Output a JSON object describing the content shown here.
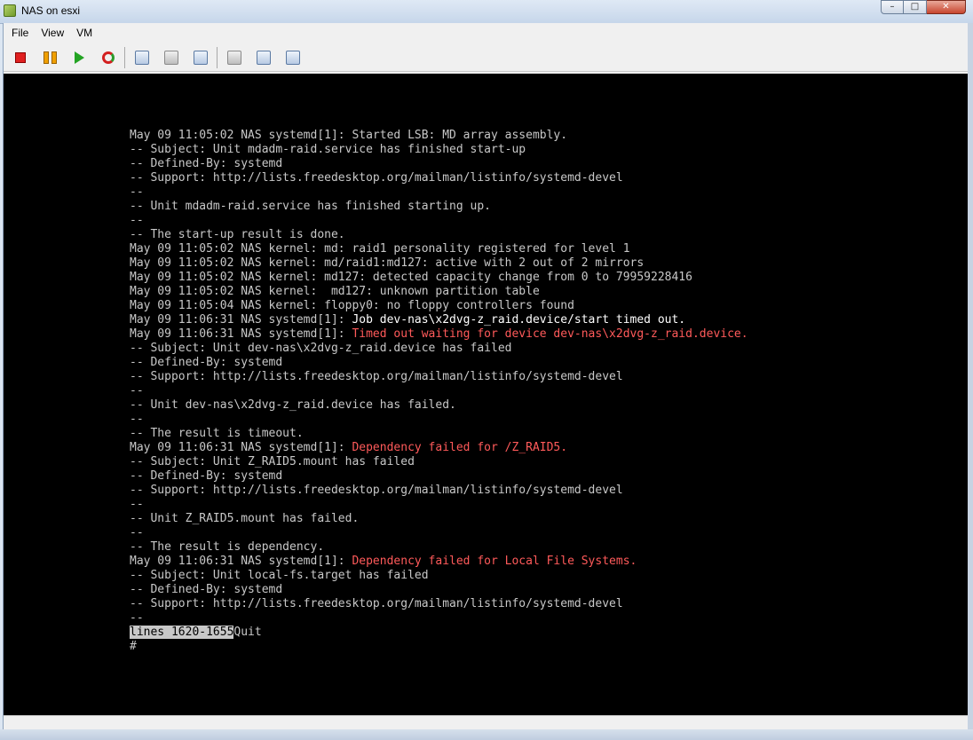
{
  "window": {
    "title": "NAS on esxi",
    "controls": [
      "–",
      "□",
      "✕"
    ]
  },
  "menu": [
    "File",
    "View",
    "VM"
  ],
  "toolbar": {
    "buttons": [
      {
        "name": "power-off-button",
        "icon": "stop-icon"
      },
      {
        "name": "suspend-button",
        "icon": "pause-icon"
      },
      {
        "name": "power-on-button",
        "icon": "play-icon"
      },
      {
        "name": "reset-button",
        "icon": "reset-icon"
      },
      {
        "name": "snapshot-button",
        "icon": "snapshot-icon"
      },
      {
        "name": "revert-snapshot-button",
        "icon": "revert-icon"
      },
      {
        "name": "snapshot-manager-button",
        "icon": "snapshot-manager-icon"
      },
      {
        "name": "send-ctrl-alt-del-button",
        "icon": "keyboard-icon"
      },
      {
        "name": "settings-button",
        "icon": "settings-icon"
      },
      {
        "name": "vm-options-button",
        "icon": "options-icon"
      }
    ]
  },
  "console": {
    "lines": [
      {
        "text": "May 09 11:05:02 NAS systemd[1]: Started LSB: MD array assembly."
      },
      {
        "text": "-- Subject: Unit mdadm-raid.service has finished start-up"
      },
      {
        "text": "-- Defined-By: systemd"
      },
      {
        "text": "-- Support: http://lists.freedesktop.org/mailman/listinfo/systemd-devel"
      },
      {
        "text": "--"
      },
      {
        "text": "-- Unit mdadm-raid.service has finished starting up."
      },
      {
        "text": "--"
      },
      {
        "text": "-- The start-up result is done."
      },
      {
        "text": "May 09 11:05:02 NAS kernel: md: raid1 personality registered for level 1"
      },
      {
        "text": "May 09 11:05:02 NAS kernel: md/raid1:md127: active with 2 out of 2 mirrors"
      },
      {
        "text": "May 09 11:05:02 NAS kernel: md127: detected capacity change from 0 to 79959228416"
      },
      {
        "text": "May 09 11:05:02 NAS kernel:  md127: unknown partition table"
      },
      {
        "text": "May 09 11:05:04 NAS kernel: floppy0: no floppy controllers found"
      },
      {
        "prefix": "May 09 11:06:31 NAS systemd[1]: ",
        "text": "Job dev-nas\\x2dvg-z_raid.device/start timed out.",
        "style": "white"
      },
      {
        "prefix": "May 09 11:06:31 NAS systemd[1]: ",
        "text": "Timed out waiting for device dev-nas\\x2dvg-z_raid.device.",
        "style": "red"
      },
      {
        "text": "-- Subject: Unit dev-nas\\x2dvg-z_raid.device has failed"
      },
      {
        "text": "-- Defined-By: systemd"
      },
      {
        "text": "-- Support: http://lists.freedesktop.org/mailman/listinfo/systemd-devel"
      },
      {
        "text": "--"
      },
      {
        "text": "-- Unit dev-nas\\x2dvg-z_raid.device has failed."
      },
      {
        "text": "--"
      },
      {
        "text": "-- The result is timeout."
      },
      {
        "prefix": "May 09 11:06:31 NAS systemd[1]: ",
        "text": "Dependency failed for /Z_RAID5.",
        "style": "red"
      },
      {
        "text": "-- Subject: Unit Z_RAID5.mount has failed"
      },
      {
        "text": "-- Defined-By: systemd"
      },
      {
        "text": "-- Support: http://lists.freedesktop.org/mailman/listinfo/systemd-devel"
      },
      {
        "text": "--"
      },
      {
        "text": "-- Unit Z_RAID5.mount has failed."
      },
      {
        "text": "--"
      },
      {
        "text": "-- The result is dependency."
      },
      {
        "prefix": "May 09 11:06:31 NAS systemd[1]: ",
        "text": "Dependency failed for Local File Systems.",
        "style": "red"
      },
      {
        "text": "-- Subject: Unit local-fs.target has failed"
      },
      {
        "text": "-- Defined-By: systemd"
      },
      {
        "text": "-- Support: http://lists.freedesktop.org/mailman/listinfo/systemd-devel"
      },
      {
        "text": "--"
      }
    ],
    "pager_status": "lines 1620-1655",
    "pager_after": "Quit",
    "prompt": "#"
  },
  "colors": {
    "console_bg": "#000000",
    "console_text": "#c8c8c8",
    "error_text": "#ff5a5a",
    "bright_text": "#ffffff"
  }
}
